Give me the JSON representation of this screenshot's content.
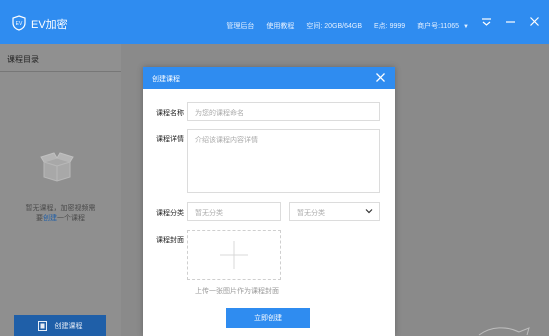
{
  "app": {
    "name": "EV加密",
    "logo_text": "EV"
  },
  "top_nav": {
    "admin": "管理后台",
    "tutorial": "使用教程",
    "space": "空间: 20GB/64GB",
    "edu": "E点: 9999",
    "account": "商户号:11065"
  },
  "window_controls": [
    "menu-icon",
    "minimize-icon",
    "close-icon"
  ],
  "sidebar": {
    "title": "课程目录",
    "empty_line1": "暂无课程，加密视频需",
    "empty_line2_prefix": "要",
    "empty_line2_link": "创建",
    "empty_line2_suffix": "一个课程",
    "create_button": "创建课程"
  },
  "modal": {
    "title": "创建课程",
    "fields": {
      "name": {
        "label": "课程名称",
        "placeholder": "为您的课程命名"
      },
      "detail": {
        "label": "课程详情",
        "placeholder": "介绍该课程内容详情"
      },
      "category": {
        "label": "课程分类",
        "primary_placeholder": "暂无分类",
        "secondary_placeholder": "暂无分类"
      },
      "cover": {
        "label": "课程封面",
        "hint": "上传一张图片作为课程封面"
      }
    },
    "submit": "立即创建"
  },
  "colors": {
    "primary": "#2f8cf0",
    "dark_button": "#1f5fa8",
    "overlay": "#8a8a8a"
  }
}
